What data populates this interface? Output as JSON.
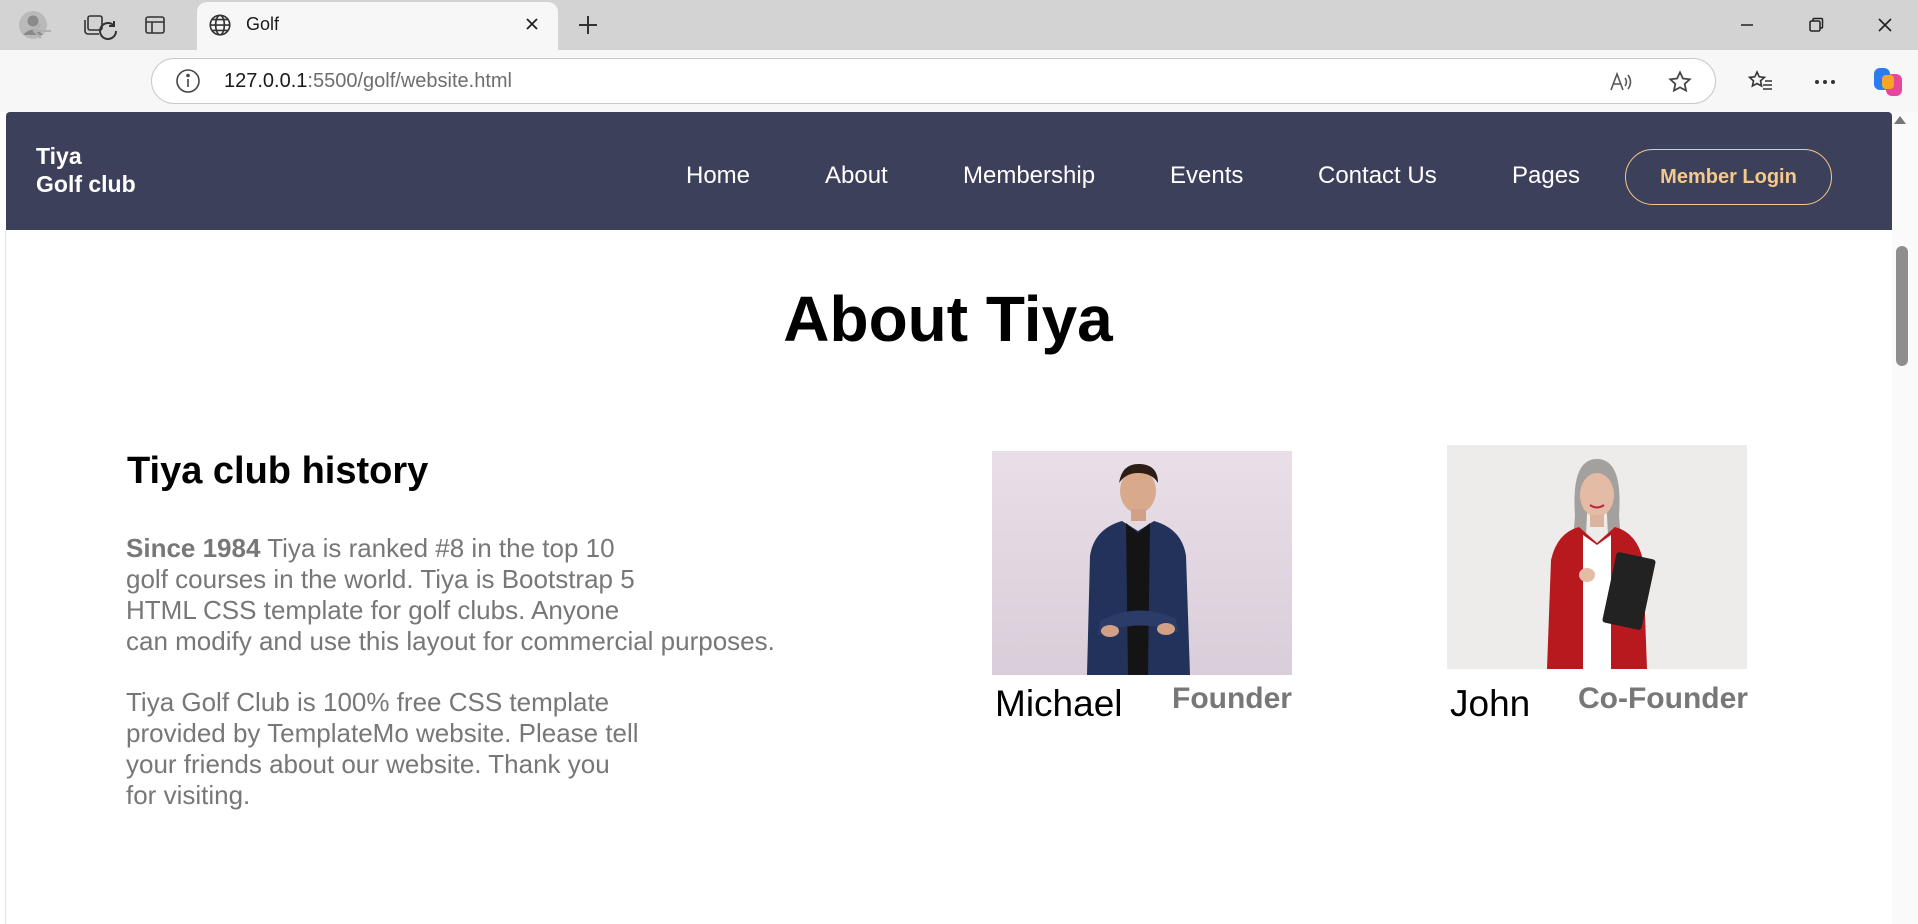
{
  "browser": {
    "tab_title": "Golf",
    "url_host": "127.0.0.1",
    "url_rest": ":5500/golf/website.html"
  },
  "site": {
    "brand_line1": "Tiya",
    "brand_line2": "Golf club",
    "nav": [
      "Home",
      "About",
      "Membership",
      "Events",
      "Contact Us",
      "Pages"
    ],
    "login_label": "Member Login",
    "accent_color": "#f4c98a",
    "nav_bg": "#3d405b"
  },
  "about": {
    "title": "About Tiya",
    "history_title": "Tiya club history",
    "p1_bold": "Since 1984",
    "p1_line1": " Tiya is ranked #8 in the top 10",
    "p1_line2": "golf courses in the world. Tiya is Bootstrap 5",
    "p1_line3": "HTML CSS template for golf clubs. Anyone",
    "p1_line4": "can modify and use this layout for commercial purposes.",
    "p2_line1": "Tiya Golf Club is 100% free CSS template",
    "p2_line2": "provided by TemplateMo website. Please tell",
    "p2_line3": "your friends about our website. Thank you",
    "p2_line4": "for visiting."
  },
  "team": [
    {
      "name": "Michael",
      "role": "Founder"
    },
    {
      "name": "John",
      "role": "Co-Founder"
    }
  ]
}
